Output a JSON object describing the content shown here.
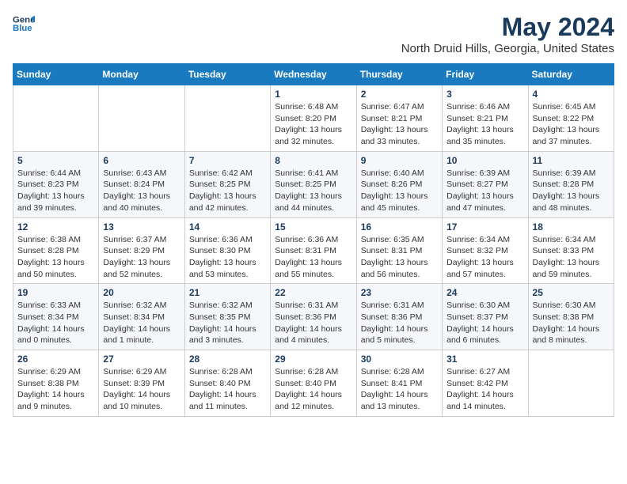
{
  "header": {
    "logo_line1": "General",
    "logo_line2": "Blue",
    "title": "May 2024",
    "subtitle": "North Druid Hills, Georgia, United States"
  },
  "days_of_week": [
    "Sunday",
    "Monday",
    "Tuesday",
    "Wednesday",
    "Thursday",
    "Friday",
    "Saturday"
  ],
  "weeks": [
    [
      {
        "num": "",
        "info": ""
      },
      {
        "num": "",
        "info": ""
      },
      {
        "num": "",
        "info": ""
      },
      {
        "num": "1",
        "info": "Sunrise: 6:48 AM\nSunset: 8:20 PM\nDaylight: 13 hours\nand 32 minutes."
      },
      {
        "num": "2",
        "info": "Sunrise: 6:47 AM\nSunset: 8:21 PM\nDaylight: 13 hours\nand 33 minutes."
      },
      {
        "num": "3",
        "info": "Sunrise: 6:46 AM\nSunset: 8:21 PM\nDaylight: 13 hours\nand 35 minutes."
      },
      {
        "num": "4",
        "info": "Sunrise: 6:45 AM\nSunset: 8:22 PM\nDaylight: 13 hours\nand 37 minutes."
      }
    ],
    [
      {
        "num": "5",
        "info": "Sunrise: 6:44 AM\nSunset: 8:23 PM\nDaylight: 13 hours\nand 39 minutes."
      },
      {
        "num": "6",
        "info": "Sunrise: 6:43 AM\nSunset: 8:24 PM\nDaylight: 13 hours\nand 40 minutes."
      },
      {
        "num": "7",
        "info": "Sunrise: 6:42 AM\nSunset: 8:25 PM\nDaylight: 13 hours\nand 42 minutes."
      },
      {
        "num": "8",
        "info": "Sunrise: 6:41 AM\nSunset: 8:25 PM\nDaylight: 13 hours\nand 44 minutes."
      },
      {
        "num": "9",
        "info": "Sunrise: 6:40 AM\nSunset: 8:26 PM\nDaylight: 13 hours\nand 45 minutes."
      },
      {
        "num": "10",
        "info": "Sunrise: 6:39 AM\nSunset: 8:27 PM\nDaylight: 13 hours\nand 47 minutes."
      },
      {
        "num": "11",
        "info": "Sunrise: 6:39 AM\nSunset: 8:28 PM\nDaylight: 13 hours\nand 48 minutes."
      }
    ],
    [
      {
        "num": "12",
        "info": "Sunrise: 6:38 AM\nSunset: 8:28 PM\nDaylight: 13 hours\nand 50 minutes."
      },
      {
        "num": "13",
        "info": "Sunrise: 6:37 AM\nSunset: 8:29 PM\nDaylight: 13 hours\nand 52 minutes."
      },
      {
        "num": "14",
        "info": "Sunrise: 6:36 AM\nSunset: 8:30 PM\nDaylight: 13 hours\nand 53 minutes."
      },
      {
        "num": "15",
        "info": "Sunrise: 6:36 AM\nSunset: 8:31 PM\nDaylight: 13 hours\nand 55 minutes."
      },
      {
        "num": "16",
        "info": "Sunrise: 6:35 AM\nSunset: 8:31 PM\nDaylight: 13 hours\nand 56 minutes."
      },
      {
        "num": "17",
        "info": "Sunrise: 6:34 AM\nSunset: 8:32 PM\nDaylight: 13 hours\nand 57 minutes."
      },
      {
        "num": "18",
        "info": "Sunrise: 6:34 AM\nSunset: 8:33 PM\nDaylight: 13 hours\nand 59 minutes."
      }
    ],
    [
      {
        "num": "19",
        "info": "Sunrise: 6:33 AM\nSunset: 8:34 PM\nDaylight: 14 hours\nand 0 minutes."
      },
      {
        "num": "20",
        "info": "Sunrise: 6:32 AM\nSunset: 8:34 PM\nDaylight: 14 hours\nand 1 minute."
      },
      {
        "num": "21",
        "info": "Sunrise: 6:32 AM\nSunset: 8:35 PM\nDaylight: 14 hours\nand 3 minutes."
      },
      {
        "num": "22",
        "info": "Sunrise: 6:31 AM\nSunset: 8:36 PM\nDaylight: 14 hours\nand 4 minutes."
      },
      {
        "num": "23",
        "info": "Sunrise: 6:31 AM\nSunset: 8:36 PM\nDaylight: 14 hours\nand 5 minutes."
      },
      {
        "num": "24",
        "info": "Sunrise: 6:30 AM\nSunset: 8:37 PM\nDaylight: 14 hours\nand 6 minutes."
      },
      {
        "num": "25",
        "info": "Sunrise: 6:30 AM\nSunset: 8:38 PM\nDaylight: 14 hours\nand 8 minutes."
      }
    ],
    [
      {
        "num": "26",
        "info": "Sunrise: 6:29 AM\nSunset: 8:38 PM\nDaylight: 14 hours\nand 9 minutes."
      },
      {
        "num": "27",
        "info": "Sunrise: 6:29 AM\nSunset: 8:39 PM\nDaylight: 14 hours\nand 10 minutes."
      },
      {
        "num": "28",
        "info": "Sunrise: 6:28 AM\nSunset: 8:40 PM\nDaylight: 14 hours\nand 11 minutes."
      },
      {
        "num": "29",
        "info": "Sunrise: 6:28 AM\nSunset: 8:40 PM\nDaylight: 14 hours\nand 12 minutes."
      },
      {
        "num": "30",
        "info": "Sunrise: 6:28 AM\nSunset: 8:41 PM\nDaylight: 14 hours\nand 13 minutes."
      },
      {
        "num": "31",
        "info": "Sunrise: 6:27 AM\nSunset: 8:42 PM\nDaylight: 14 hours\nand 14 minutes."
      },
      {
        "num": "",
        "info": ""
      }
    ]
  ]
}
